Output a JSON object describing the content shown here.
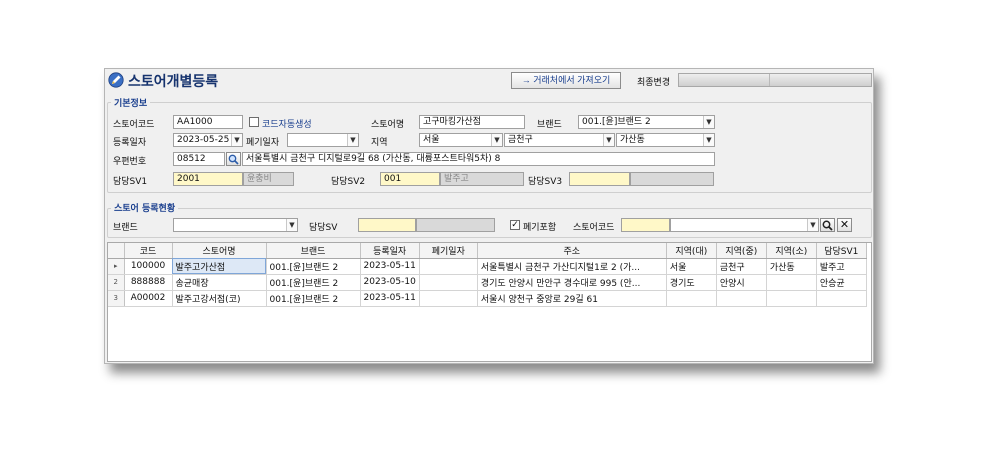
{
  "header": {
    "title": "스토어개별등록",
    "fetch_button": "→ 거래처에서 가져오기",
    "last_modified_label": "최종변경"
  },
  "basic": {
    "section_title": "기본정보",
    "store_code_label": "스토어코드",
    "store_code_value": "AA1000",
    "auto_code_label": "코드자동생성",
    "store_name_label": "스토어명",
    "store_name_value": "고구마킹가산점",
    "brand_label": "브랜드",
    "brand_value": "001.[윤]브랜드 2",
    "reg_date_label": "등록일자",
    "reg_date_value": "2023-05-25",
    "closed_date_label": "폐기일자",
    "closed_date_value": "",
    "region_label": "지역",
    "region_large": "서울",
    "region_mid": "금천구",
    "region_small": "가산동",
    "zip_label": "우편번호",
    "zip_value": "08512",
    "address_value": "서울특별시 금천구 디지털로9길 68 (가산동, 대륭포스트타워5차) 8",
    "sv1_label": "담당SV1",
    "sv1_code": "2001",
    "sv1_name": "윤충비",
    "sv2_label": "담당SV2",
    "sv2_code": "001",
    "sv2_name": "발주고",
    "sv3_label": "담당SV3",
    "sv3_code": "",
    "sv3_name": ""
  },
  "search": {
    "section_title": "스토어 등록현황",
    "brand_label": "브랜드",
    "brand_value": "",
    "sv_label": "담당SV",
    "sv_code": "",
    "sv_name": "",
    "include_closed_label": "폐기포함",
    "include_closed_checked": "✓",
    "store_code_label": "스토어코드",
    "store_code_value": "",
    "store_name_value": ""
  },
  "grid": {
    "columns": [
      "코드",
      "스토어명",
      "브랜드",
      "등록일자",
      "폐기일자",
      "주소",
      "지역(대)",
      "지역(중)",
      "지역(소)",
      "담당SV1"
    ],
    "rows": [
      {
        "indicator": "▸",
        "cells": [
          "100000",
          "발주고가산점",
          "001.[윤]브랜드 2",
          "2023-05-11",
          "",
          "서울특별시 금천구 가산디지털1로 2 (가...",
          "서울",
          "금천구",
          "가산동",
          "발주고"
        ]
      },
      {
        "indicator": "2",
        "cells": [
          "888888",
          "송균매장",
          "001.[윤]브랜드 2",
          "2023-05-10",
          "",
          "경기도 안양시 만안구 경수대로 995 (안...",
          "경기도",
          "안양시",
          "",
          "안승균"
        ]
      },
      {
        "indicator": "3",
        "cells": [
          "A00002",
          "발주고강서점(코)",
          "001.[윤]브랜드 2",
          "2023-05-11",
          "",
          "서울시 양천구 중앙로 29길 61",
          "",
          "",
          "",
          ""
        ]
      }
    ]
  }
}
